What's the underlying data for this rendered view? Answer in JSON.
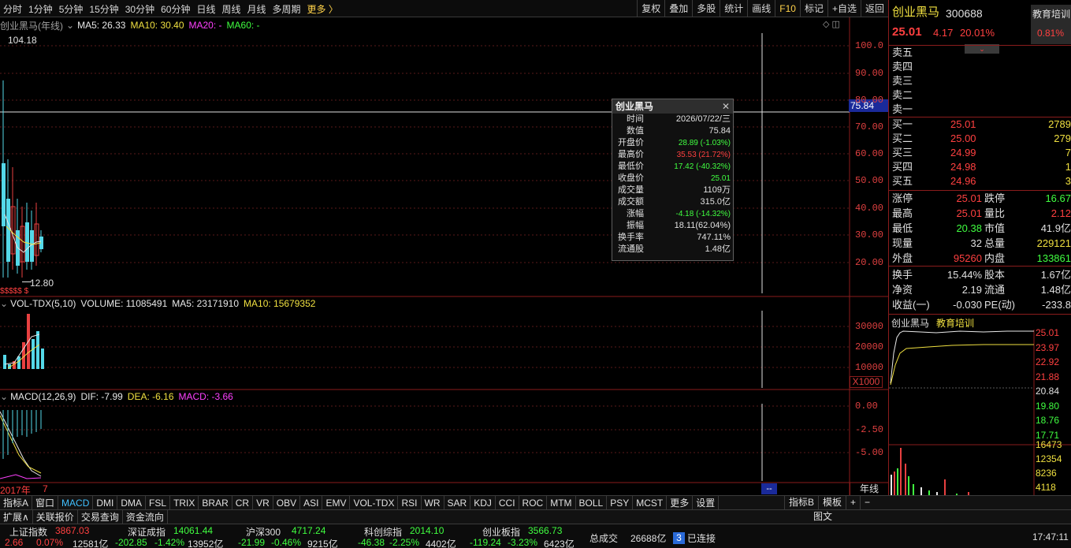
{
  "top_menu": [
    "分时",
    "1分钟",
    "5分钟",
    "15分钟",
    "30分钟",
    "60分钟",
    "日线",
    "周线",
    "月线",
    "多周期"
  ],
  "top_more": "更多 〉",
  "top_right": [
    "复权",
    "叠加",
    "多股",
    "统计",
    "画线",
    "F10",
    "标记",
    "+自选",
    "返回"
  ],
  "main": {
    "name": "创业黑马",
    "period": "(年线)",
    "ma5": "MA5: 26.33",
    "ma10": "MA10: 30.40",
    "ma20": "MA20: -",
    "ma60": "MA60: -",
    "high_label": "104.18",
    "low_label": "12.80",
    "cross_price": "75.84",
    "axis": [
      "100.0",
      "90.00",
      "80.00",
      "70.00",
      "60.00",
      "50.00",
      "40.00",
      "30.00",
      "20.00"
    ]
  },
  "vol": {
    "label": "VOL-TDX(5,10)",
    "volume": "VOLUME: 11085491",
    "ma5": "MA5: 23171910",
    "ma10": "MA10: 15679352",
    "axis": [
      "30000",
      "20000",
      "10000"
    ],
    "unit": "X1000"
  },
  "macd": {
    "label": "MACD(12,26,9)",
    "dif": "DIF: -7.99",
    "dea": "DEA: -6.16",
    "macd": "MACD: -3.66",
    "axis": [
      "0.00",
      "-2.50",
      "-5.00"
    ]
  },
  "time_axis": {
    "start": "2017年",
    "mark": "7",
    "period_btn": "年线",
    "cursor_box": "--"
  },
  "tooltip": {
    "title": "创业黑马",
    "close": "✕",
    "rows": [
      {
        "k": "时间",
        "v": "2026/07/22/三",
        "c": ""
      },
      {
        "k": "数值",
        "v": "75.84",
        "c": ""
      },
      {
        "k": "开盘价",
        "v": "28.89 (-1.03%)",
        "c": "g"
      },
      {
        "k": "最高价",
        "v": "35.53 (21.72%)",
        "c": "r"
      },
      {
        "k": "最低价",
        "v": "17.42 (-40.32%)",
        "c": "g"
      },
      {
        "k": "收盘价",
        "v": "25.01",
        "c": "g"
      },
      {
        "k": "成交量",
        "v": "1109万",
        "c": ""
      },
      {
        "k": "成交额",
        "v": "315.0亿",
        "c": ""
      },
      {
        "k": "涨幅",
        "v": "-4.18 (-14.32%)",
        "c": "g"
      },
      {
        "k": "振幅",
        "v": "18.11(62.04%)",
        "c": ""
      },
      {
        "k": "换手率",
        "v": "747.11%",
        "c": ""
      },
      {
        "k": "流通股",
        "v": "1.48亿",
        "c": ""
      }
    ]
  },
  "quote": {
    "name": "创业黑马",
    "code": "300688",
    "price": "25.01",
    "change": "4.17",
    "pct": "20.01%",
    "tag": "教育培训",
    "tag_pct": "0.81%",
    "sells": [
      "卖五",
      "卖四",
      "卖三",
      "卖二",
      "卖一"
    ],
    "buys": [
      {
        "k": "买一",
        "p": "25.01",
        "v": "2789"
      },
      {
        "k": "买二",
        "p": "25.00",
        "v": "279"
      },
      {
        "k": "买三",
        "p": "24.99",
        "v": "7"
      },
      {
        "k": "买四",
        "p": "24.98",
        "v": "1"
      },
      {
        "k": "买五",
        "p": "24.96",
        "v": "3"
      }
    ],
    "stats": [
      {
        "k1": "涨停",
        "v1": "25.01",
        "k2": "跌停",
        "v2": "16.67"
      },
      {
        "k1": "最高",
        "v1": "25.01",
        "k2": "量比",
        "v2": "2.12"
      },
      {
        "k1": "最低",
        "v1": "20.38",
        "k2": "市值",
        "v2": "41.9亿"
      },
      {
        "k1": "现量",
        "v1": "32",
        "k2": "总量",
        "v2": "229121"
      },
      {
        "k1": "外盘",
        "v1": "95260",
        "k2": "内盘",
        "v2": "133861"
      }
    ],
    "stats2": [
      {
        "k1": "换手",
        "v1": "15.44%",
        "k2": "股本",
        "v2": "1.67亿"
      },
      {
        "k1": "净资",
        "v1": "2.19",
        "k2": "流通",
        "v2": "1.48亿"
      },
      {
        "k1": "收益(一)",
        "v1": "-0.030",
        "k2": "PE(动)",
        "v2": "-233.8"
      }
    ],
    "mini_title": "创业黑马",
    "mini_tag": "教育培训",
    "mini_axis": [
      "25.01",
      "23.97",
      "22.92",
      "21.88",
      "20.84",
      "19.80",
      "18.76",
      "17.71"
    ],
    "mini_vol": [
      "16473",
      "12354",
      "8236",
      "4118"
    ]
  },
  "indicators": [
    "指标A",
    "窗口",
    "MACD",
    "DMI",
    "DMA",
    "FSL",
    "TRIX",
    "BRAR",
    "CR",
    "VR",
    "OBV",
    "ASI",
    "EMV",
    "VOL-TDX",
    "RSI",
    "WR",
    "SAR",
    "KDJ",
    "CCI",
    "ROC",
    "MTM",
    "BOLL",
    "PSY",
    "MCST",
    "更多",
    "设置"
  ],
  "indicators_right": [
    "指标B",
    "模板",
    "+",
    "−"
  ],
  "bottom_btns": [
    "扩展∧",
    "关联报价",
    "交易查询",
    "资金流向"
  ],
  "bottom_right": "图文",
  "status": {
    "sh": {
      "name": "上证指数",
      "val": "3867.03",
      "chg": "2.66",
      "pct": "0.07%",
      "amt": "12581亿"
    },
    "sz": {
      "name": "深证成指",
      "val": "14061.44",
      "chg": "-202.85",
      "pct": "-1.42%",
      "amt": "13952亿"
    },
    "hs": {
      "name": "沪深300",
      "val": "4717.24",
      "chg": "-21.99",
      "pct": "-0.46%",
      "amt": "9215亿"
    },
    "kc": {
      "name": "科创综指",
      "val": "2014.10",
      "chg": "-46.38",
      "pct": "-2.25%",
      "amt": "4402亿"
    },
    "cy": {
      "name": "创业板指",
      "val": "3566.73",
      "chg": "-119.24",
      "pct": "-3.23%",
      "amt": "6423亿"
    },
    "total_label": "总成交",
    "total": "26688亿",
    "conn_num": "3",
    "conn": "已连接",
    "time": "17:47:11"
  }
}
